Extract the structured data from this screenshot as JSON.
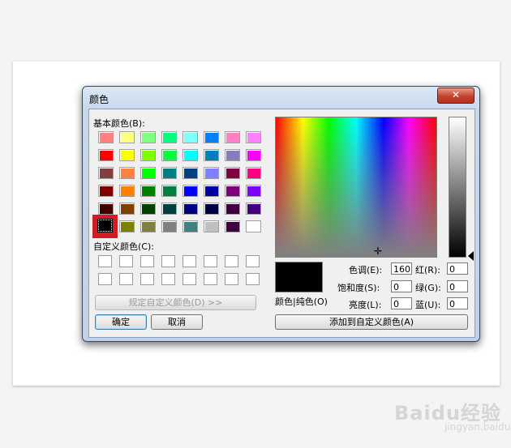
{
  "window": {
    "title": "颜色",
    "close_glyph": "✕"
  },
  "basic_colors": {
    "label": "基本颜色(B):",
    "rows": [
      [
        "#ff8080",
        "#ffff80",
        "#80ff80",
        "#00ff80",
        "#80ffff",
        "#0080ff",
        "#ff80c0",
        "#ff80ff"
      ],
      [
        "#ff0000",
        "#ffff00",
        "#80ff00",
        "#00ff40",
        "#00ffff",
        "#0080c0",
        "#8080c0",
        "#ff00ff"
      ],
      [
        "#804040",
        "#ff8040",
        "#00ff00",
        "#008080",
        "#004080",
        "#8080ff",
        "#800040",
        "#ff0080"
      ],
      [
        "#800000",
        "#ff8000",
        "#008000",
        "#008040",
        "#0000ff",
        "#0000a0",
        "#800080",
        "#8000ff"
      ],
      [
        "#400000",
        "#804000",
        "#004000",
        "#004040",
        "#000080",
        "#000040",
        "#400040",
        "#400080"
      ],
      [
        "#000000",
        "#808000",
        "#808040",
        "#808080",
        "#408080",
        "#c0c0c0",
        "#400040",
        "#ffffff"
      ]
    ],
    "selected_color": "#000000",
    "highlight_color": "#d51b22"
  },
  "custom_colors": {
    "label": "自定义颜色(C):",
    "rows": 2,
    "cols": 8
  },
  "buttons": {
    "define_custom": "规定自定义颜色(D) >>",
    "ok": "确定",
    "cancel": "取消",
    "add_custom": "添加到自定义颜色(A)"
  },
  "preview": {
    "label": "颜色|纯色(O)",
    "color": "#000000"
  },
  "fields": {
    "hue": {
      "label": "色调(E):",
      "value": "160"
    },
    "sat": {
      "label": "饱和度(S):",
      "value": "0"
    },
    "lum": {
      "label": "亮度(L):",
      "value": "0"
    },
    "red": {
      "label": "红(R):",
      "value": "0"
    },
    "green": {
      "label": "绿(G):",
      "value": "0"
    },
    "blue": {
      "label": "蓝(U):",
      "value": "0"
    }
  },
  "watermark": {
    "brand": "Baidu经验",
    "url": "jingyan.baidu.com"
  }
}
